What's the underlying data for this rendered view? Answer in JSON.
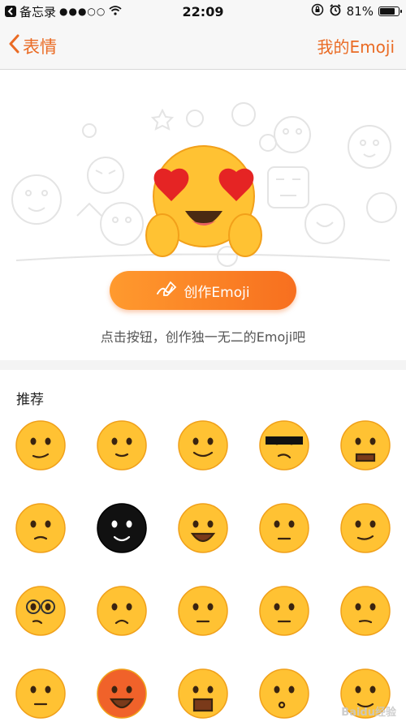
{
  "status_bar": {
    "app_back": "备忘录",
    "signal": "●●●○○",
    "time": "22:09",
    "battery_percent": "81%",
    "battery_level": 0.81
  },
  "nav": {
    "back_label": "表情",
    "right_label": "我的Emoji"
  },
  "hero": {
    "create_button_label": "创作Emoji",
    "hint": "点击按钮，创作独一无二的Emoji吧"
  },
  "recommend": {
    "title": "推荐",
    "emojis": [
      "thinking-face",
      "covering-eyes-face",
      "tearful-face",
      "cool-sunglasses-face",
      "angry-face",
      "facepalm-face",
      "black-furry-face",
      "grinning-face",
      "skeptical-face",
      "smirking-face",
      "glasses-face",
      "worried-face",
      "disappointed-face",
      "unamused-face",
      "pondering-face",
      "smug-face",
      "furious-face",
      "crying-face",
      "whistling-face",
      "laughing-face"
    ]
  },
  "watermark": "Baidu经验",
  "colors": {
    "accent": "#ea6b24",
    "button_start": "#ff9a2e",
    "button_end": "#f76f1f",
    "emoji_yellow": "#ffc233"
  }
}
